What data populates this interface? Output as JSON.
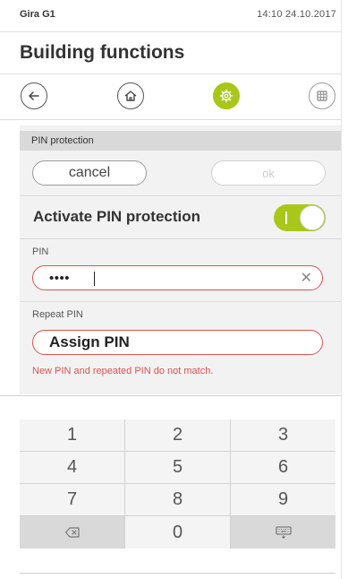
{
  "statusbar": {
    "brand": "Gira G1",
    "time": "14:10",
    "date": "24.10.2017"
  },
  "header": {
    "title": "Building functions"
  },
  "nav": [
    {
      "name": "back",
      "icon": "arrow-left-icon"
    },
    {
      "name": "home",
      "icon": "home-icon"
    },
    {
      "name": "settings",
      "icon": "gear-icon",
      "active": true
    },
    {
      "name": "grid",
      "icon": "grid-icon"
    }
  ],
  "pin_section": {
    "header": "PIN protection",
    "cancel_label": "cancel",
    "ok_label": "ok",
    "toggle_label": "Activate PIN protection",
    "toggle_on": true,
    "pin_label": "PIN",
    "pin_value": "••••",
    "repeat_label": "Repeat PIN",
    "repeat_value": "Assign PIN",
    "error": "New PIN and repeated PIN do not match."
  },
  "keypad": {
    "keys": [
      "1",
      "2",
      "3",
      "4",
      "5",
      "6",
      "7",
      "8",
      "9",
      "0"
    ],
    "backspace_icon": "backspace-icon",
    "keyboard_icon": "keyboard-hide-icon"
  },
  "colors": {
    "accent": "#a9c719",
    "error": "#d9534f",
    "section_header": "#d9d9d9",
    "panel": "#f2f2f2"
  }
}
